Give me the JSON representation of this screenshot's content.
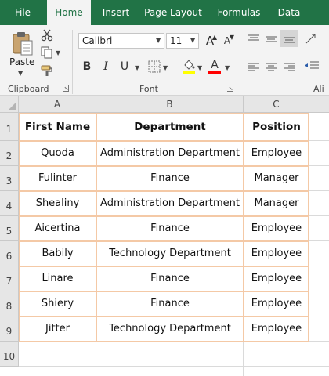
{
  "ribbon_tabs": [
    {
      "label": "File"
    },
    {
      "label": "Home"
    },
    {
      "label": "Insert"
    },
    {
      "label": "Page Layout"
    },
    {
      "label": "Formulas"
    },
    {
      "label": "Data"
    }
  ],
  "clipboard": {
    "paste_label": "Paste",
    "group_label": "Clipboard"
  },
  "font": {
    "name": "Calibri",
    "size": "11",
    "group_label": "Font",
    "grow_label": "A",
    "shrink_label": "A",
    "bold": "B",
    "italic": "I",
    "underline": "U",
    "font_color_label": "A"
  },
  "alignment": {
    "group_label": "Ali"
  },
  "grid": {
    "columns": [
      "A",
      "B",
      "C"
    ],
    "rows": [
      "1",
      "2",
      "3",
      "4",
      "5",
      "6",
      "7",
      "8",
      "9",
      "10"
    ],
    "headers": [
      "First Name",
      "Department",
      "Position"
    ],
    "data": [
      [
        "Quoda",
        "Administration Department",
        "Employee"
      ],
      [
        "Fulinter",
        "Finance",
        "Manager"
      ],
      [
        "Shealiny",
        "Administration Department",
        "Manager"
      ],
      [
        "Aicertina",
        "Finance",
        "Employee"
      ],
      [
        "Babily",
        "Technology Department",
        "Employee"
      ],
      [
        "Linare",
        "Finance",
        "Employee"
      ],
      [
        "Shiery",
        "Finance",
        "Employee"
      ],
      [
        "Jitter",
        "Technology Department",
        "Employee"
      ]
    ]
  },
  "colors": {
    "ribbon_green": "#217346",
    "table_border": "#f4c9a6",
    "highlight_yellow": "#ffff00",
    "font_color_red": "#ff0000"
  }
}
